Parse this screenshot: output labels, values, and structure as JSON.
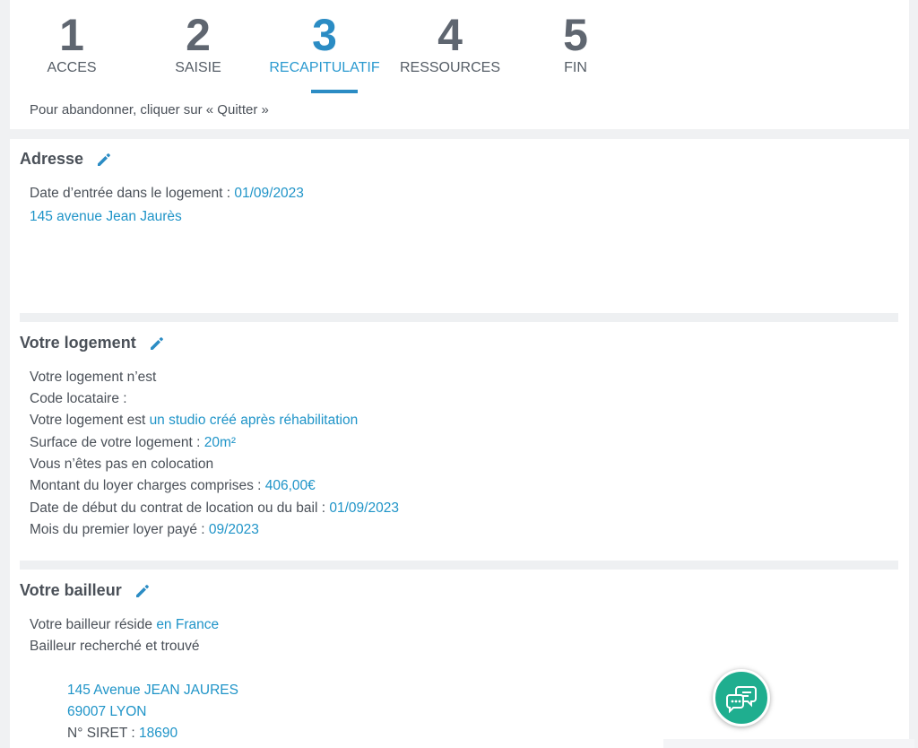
{
  "stepper": {
    "steps": [
      {
        "number": "1",
        "label": "ACCES"
      },
      {
        "number": "2",
        "label": "SAISIE"
      },
      {
        "number": "3",
        "label": "RECAPITULATIF"
      },
      {
        "number": "4",
        "label": "RESSOURCES"
      },
      {
        "number": "5",
        "label": "FIN"
      }
    ],
    "active_step": "3",
    "quit_note": "Pour abandonner, cliquer sur « Quitter »"
  },
  "adresse": {
    "title": "Adresse",
    "date_label": "Date d’entrée dans le logement : ",
    "date_value": "01/09/2023",
    "address": "145 avenue Jean Jaurès"
  },
  "logement": {
    "title": "Votre logement",
    "line1": "Votre logement n’est",
    "code_label": "Code locataire :",
    "type_label": "Votre logement est ",
    "type_value": "un studio créé après réhabilitation",
    "surface_label": "Surface de votre logement : ",
    "surface_value": "20m²",
    "coloc": "Vous n’êtes pas en colocation",
    "loyer_label": "Montant du loyer charges comprises : ",
    "loyer_value": "406,00€",
    "bail_label": "Date de début du contrat de location ou du bail : ",
    "bail_value": "01/09/2023",
    "mois_label": "Mois du premier loyer payé : ",
    "mois_value": "09/2023"
  },
  "bailleur": {
    "title": "Votre bailleur",
    "reside_label": "Votre bailleur réside ",
    "reside_value": "en France",
    "found": "Bailleur recherché et trouvé",
    "address_line1": "145 Avenue JEAN JAURES",
    "address_line2": "69007 LYON",
    "siret_label": "N° SIRET : ",
    "siret_value": "18690"
  },
  "icons": {
    "edit": "pencil-icon",
    "chat": "chat-bubbles-icon"
  },
  "colors": {
    "accent": "#2b8cc4",
    "value": "#1f94c8",
    "chat": "#1fae8f"
  }
}
